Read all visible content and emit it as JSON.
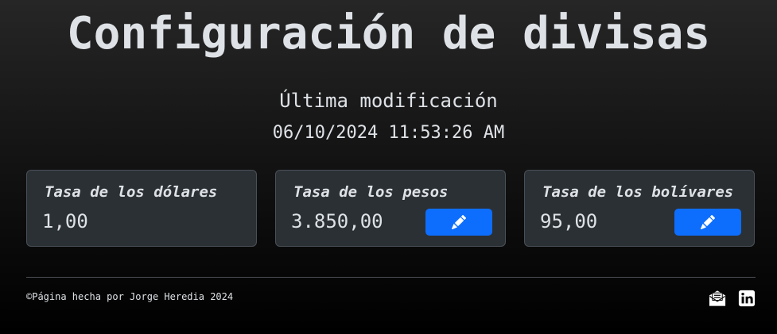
{
  "page": {
    "title": "Configuración de divisas",
    "last_modified_label": "Última modificación",
    "last_modified_value": "06/10/2024 11:53:26 AM"
  },
  "cards": [
    {
      "title": "Tasa de los dólares",
      "value": "1,00",
      "editable": false
    },
    {
      "title": "Tasa de los pesos",
      "value": "3.850,00",
      "editable": true,
      "button_icon": "pencil-icon"
    },
    {
      "title": "Tasa de los bolívares",
      "value": "95,00",
      "editable": true,
      "button_icon": "pencil-icon"
    }
  ],
  "footer": {
    "text": "©Página hecha por Jorge Heredia 2024",
    "icons": [
      "envelope-open-icon",
      "linkedin-icon"
    ]
  },
  "colors": {
    "accent": "#0d6efd",
    "card_background": "#2b3035",
    "text": "#dee2e6"
  }
}
